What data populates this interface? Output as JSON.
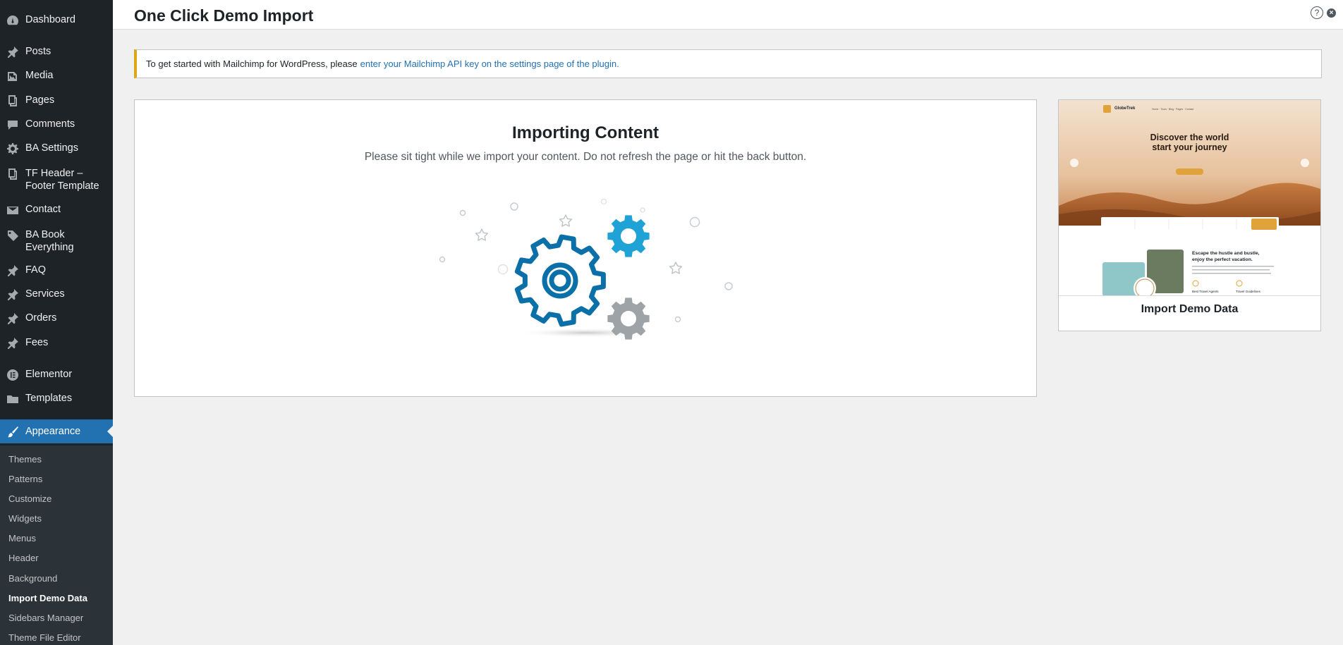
{
  "sidebar": {
    "items": [
      {
        "label": "Dashboard",
        "icon": "dashboard-icon"
      },
      {
        "label": "Posts",
        "icon": "pin-icon"
      },
      {
        "label": "Media",
        "icon": "media-icon"
      },
      {
        "label": "Pages",
        "icon": "pages-icon"
      },
      {
        "label": "Comments",
        "icon": "comments-icon"
      },
      {
        "label": "BA Settings",
        "icon": "gear-icon"
      },
      {
        "label": "TF Header –\nFooter Template",
        "icon": "pages-icon"
      },
      {
        "label": "Contact",
        "icon": "mail-icon"
      },
      {
        "label": "BA Book\nEverything",
        "icon": "tag-icon"
      },
      {
        "label": "FAQ",
        "icon": "pin-icon"
      },
      {
        "label": "Services",
        "icon": "pin-icon"
      },
      {
        "label": "Orders",
        "icon": "pin-icon"
      },
      {
        "label": "Fees",
        "icon": "pin-icon"
      },
      {
        "label": "Elementor",
        "icon": "elementor-icon"
      },
      {
        "label": "Templates",
        "icon": "folder-icon"
      }
    ],
    "active": {
      "label": "Appearance",
      "icon": "brush-icon"
    },
    "submenu": [
      "Themes",
      "Patterns",
      "Customize",
      "Widgets",
      "Menus",
      "Header",
      "Background",
      "Import Demo Data",
      "Sidebars Manager",
      "Theme File Editor"
    ],
    "submenu_current": "Import Demo Data"
  },
  "header": {
    "title": "One Click Demo Import",
    "help_symbol": "?",
    "close_symbol": "×"
  },
  "notice": {
    "text": "To get started with Mailchimp for WordPress, please",
    "link_text": "enter your Mailchimp API key on the settings page of the plugin."
  },
  "import": {
    "title": "Importing Content",
    "subtitle": "Please sit tight while we import your content. Do not refresh the page or hit the back button."
  },
  "demo": {
    "label": "Import Demo Data",
    "preview": {
      "brand": "GlobeTrek",
      "headline_1": "Discover the world",
      "headline_2": "start your journey",
      "section_1": "Escape the hustle and bustle,",
      "section_2": "enjoy the perfect vacation.",
      "feature_1": "Best Travel Agents",
      "feature_2": "Travel Guidelines"
    }
  },
  "colors": {
    "sidebar_bg": "#1d2327",
    "accent": "#2271b1",
    "notice_border": "#dba617",
    "gear_primary": "#0b6fa8",
    "gear_secondary": "#1fa3d6",
    "gear_gray": "#9ea3a8"
  }
}
